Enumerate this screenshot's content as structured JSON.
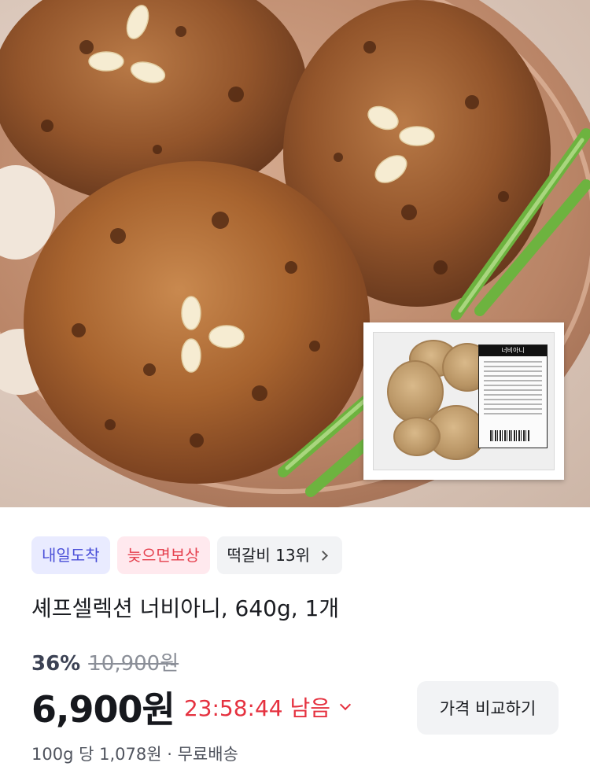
{
  "product": {
    "image_alt": "너비아니 product photo",
    "package_label": "너비아니",
    "tags": {
      "delivery": "내일도착",
      "late_guarantee": "늦으면보상",
      "rank": "떡갈비 13위"
    },
    "title": "셰프셀렉션 너비아니, 640g, 1개",
    "pricing": {
      "discount_rate": "36%",
      "original_price": "10,900원",
      "sale_price": "6,900원",
      "timer": "23:58:44 남음",
      "compare_button": "가격 비교하기",
      "unit_price": "100g 당 1,078원",
      "separator": "·",
      "shipping": "무료배송"
    }
  },
  "colors": {
    "delivery_tag_text": "#4a4fd8",
    "delivery_tag_bg": "#e9ebff",
    "guarantee_tag_text": "#e5414f",
    "guarantee_tag_bg": "#ffe9ee",
    "timer": "#e5313f"
  },
  "icons": [
    "chevron-right-icon",
    "chevron-down-icon"
  ]
}
